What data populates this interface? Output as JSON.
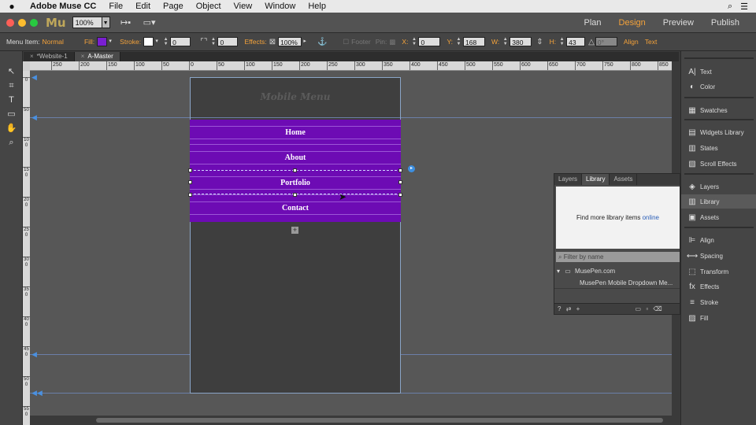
{
  "menubar": {
    "app_name": "Adobe Muse CC",
    "items": [
      "File",
      "Edit",
      "Page",
      "Object",
      "View",
      "Window",
      "Help"
    ]
  },
  "header": {
    "logo": "Mu",
    "zoom": "100%",
    "modes": [
      "Plan",
      "Design",
      "Preview",
      "Publish"
    ],
    "active_mode": "Design"
  },
  "controlbar": {
    "menu_item_label": "Menu Item:",
    "menu_item_state": "Normal",
    "fill_label": "Fill:",
    "fill_color": "#7a1fd1",
    "stroke_label": "Stroke:",
    "stroke_width": "0",
    "corner_radius": "0",
    "effects_label": "Effects:",
    "opacity": "100%",
    "footer_label": "Footer",
    "pin_label": "Pin:",
    "x_label": "X:",
    "x_value": "0",
    "y_label": "Y:",
    "y_value": "168",
    "w_label": "W:",
    "w_value": "380",
    "h_label": "H:",
    "h_value": "43",
    "rotation": "0°",
    "align_label": "Align",
    "text_label": "Text"
  },
  "doctabs": [
    {
      "label": "*Website-1",
      "active": false
    },
    {
      "label": "A-Master",
      "active": true
    }
  ],
  "ruler_marks": [
    "250",
    "200",
    "150",
    "100",
    "50",
    "0",
    "50",
    "100",
    "150",
    "200",
    "250",
    "300",
    "350",
    "400",
    "450",
    "500",
    "550",
    "600",
    "650",
    "700",
    "750",
    "800",
    "850"
  ],
  "vruler_marks": [
    "0",
    "50",
    "100",
    "150",
    "200",
    "250",
    "300",
    "350",
    "400",
    "450",
    "500",
    "550"
  ],
  "canvas": {
    "header_title": "Mobile Menu",
    "menu_items": [
      "Home",
      "About",
      "Portfolio",
      "Contact"
    ],
    "menu_color": "#6d0bb4"
  },
  "right_panel": [
    {
      "label": "Text",
      "icon": "text-icon",
      "glyph": "A|"
    },
    {
      "label": "Color",
      "icon": "color-icon",
      "glyph": "◐"
    },
    {
      "label": "Swatches",
      "icon": "swatches-icon",
      "glyph": "▦"
    },
    {
      "label": "Widgets Library",
      "icon": "widgets-icon",
      "glyph": "▤"
    },
    {
      "label": "States",
      "icon": "states-icon",
      "glyph": "▥"
    },
    {
      "label": "Scroll Effects",
      "icon": "scroll-effects-icon",
      "glyph": "▧"
    },
    {
      "label": "Layers",
      "icon": "layers-icon",
      "glyph": "◈"
    },
    {
      "label": "Library",
      "icon": "library-icon",
      "glyph": "▥"
    },
    {
      "label": "Assets",
      "icon": "assets-icon",
      "glyph": "▣"
    },
    {
      "label": "Align",
      "icon": "align-icon",
      "glyph": "⊫"
    },
    {
      "label": "Spacing",
      "icon": "spacing-icon",
      "glyph": "⟷"
    },
    {
      "label": "Transform",
      "icon": "transform-icon",
      "glyph": "⬚"
    },
    {
      "label": "Effects",
      "icon": "effects-icon",
      "glyph": "fx"
    },
    {
      "label": "Stroke",
      "icon": "stroke-icon",
      "glyph": "≡"
    },
    {
      "label": "Fill",
      "icon": "fill-icon",
      "glyph": "▨"
    }
  ],
  "library_panel": {
    "tabs": [
      "Layers",
      "Library",
      "Assets"
    ],
    "active_tab": "Library",
    "preview_text": "Find more library items",
    "preview_link": "online",
    "filter_placeholder": "Filter by name",
    "folder": "MusePen.com",
    "item": "MusePen Mobile Dropdown Me..."
  }
}
